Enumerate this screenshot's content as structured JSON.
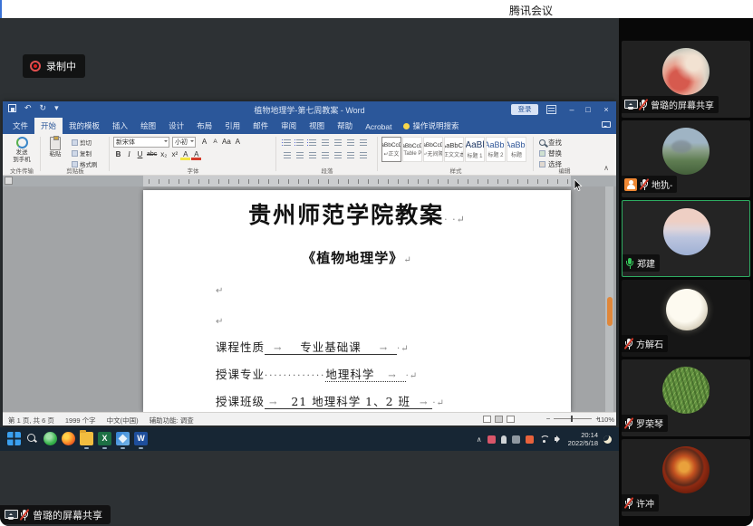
{
  "app": {
    "title": "腾讯会议",
    "recording_label": "录制中",
    "presenter_overlay": "曾璐的屏幕共享"
  },
  "word": {
    "window_title": "植物地理学-第七周教案 - Word",
    "signin_label": "登录",
    "icons": {
      "undo": "↶",
      "redo": "↻",
      "caret": "▾",
      "minimize": "–",
      "restore": "□",
      "close": "×",
      "collapse": "∧"
    },
    "tabs": [
      "文件",
      "开始",
      "我的模板",
      "插入",
      "绘图",
      "设计",
      "布局",
      "引用",
      "邮件",
      "审阅",
      "视图",
      "帮助",
      "Acrobat"
    ],
    "tellme": "操作说明搜索",
    "ribbon": {
      "file_transfer": {
        "line1": "发送",
        "line2": "到手机",
        "group": "文件传输"
      },
      "clipboard": {
        "paste": "粘贴",
        "cut": "剪切",
        "copy": "复制",
        "painter": "格式刷",
        "group": "剪贴板"
      },
      "font": {
        "name": "新宋体",
        "size": "小初",
        "bold": "B",
        "italic": "I",
        "underline": "U",
        "strike": "abc",
        "sub": "x₂",
        "sup": "x²",
        "hl": "A",
        "fc": "A",
        "group": "字体"
      },
      "paragraph": {
        "group": "段落"
      },
      "styles": {
        "group": "样式",
        "items": [
          {
            "sample": "AaBbCcDd",
            "name": "↵正文"
          },
          {
            "sample": "AaBbCcDd",
            "name": "↵Table P..."
          },
          {
            "sample": "AaBbCcDd",
            "name": "↵无间隔"
          },
          {
            "sample": "AaBbCc",
            "name": "正文文本"
          },
          {
            "sample": "AaBl",
            "name": "标题 1"
          },
          {
            "sample": "AaBb(",
            "name": "标题 2"
          },
          {
            "sample": "AaBb(",
            "name": "标题"
          }
        ]
      },
      "editing": {
        "find": "查找",
        "replace": "替换",
        "select": "选择",
        "group": "编辑"
      }
    },
    "document": {
      "title": "贵州师范学院教案",
      "title_marks": "· ·↵",
      "subtitle": "《植物地理学》",
      "subtitle_mark": "↵",
      "empty_mark": "↵",
      "tab_arrow": "→",
      "fields": [
        {
          "label": "课程性质",
          "value": "专业基础课",
          "tail": "·↵"
        },
        {
          "label": "授课专业",
          "leader": "·············",
          "value": "地理科学",
          "tail": "·↵"
        },
        {
          "label": "授课班级",
          "value": "21 地理科学 1、2 班",
          "tail": "·↵"
        }
      ]
    },
    "status": {
      "page": "第 1 页, 共 6 页",
      "words": "1999 个字",
      "lang": "中文(中国)",
      "accessibility": "辅助功能: 调查",
      "zoom": "110%",
      "zoom_minus": "−",
      "zoom_plus": "+"
    }
  },
  "taskbar": {
    "time": "20:14",
    "date": "2022/5/18"
  },
  "participants": [
    {
      "name": "曾璐的屏幕共享",
      "mic": "muted",
      "sharing": true
    },
    {
      "name": "地犰-",
      "mic": "muted",
      "badge": "person"
    },
    {
      "name": "郑建",
      "mic": "active",
      "active": true
    },
    {
      "name": "方解石",
      "mic": "muted"
    },
    {
      "name": "罗荣琴",
      "mic": "muted"
    },
    {
      "name": "许冲",
      "mic": "muted"
    }
  ]
}
